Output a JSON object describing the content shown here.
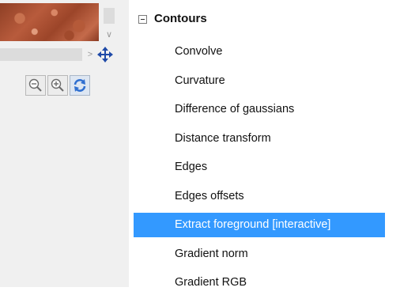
{
  "tree": {
    "category": "Contours",
    "selected_index": 6,
    "items": [
      "Convolve",
      "Curvature",
      "Difference of gaussians",
      "Distance transform",
      "Edges",
      "Edges offsets",
      "Extract foreground [interactive]",
      "Gradient norm",
      "Gradient RGB"
    ]
  },
  "toolbar": {
    "icons": [
      "zoom-out-icon",
      "zoom-in-icon",
      "refresh-icon",
      "move-icon"
    ]
  },
  "colors": {
    "selection": "#3399ff",
    "selection_text": "#ffffff",
    "move_icon": "#1f4aa8"
  }
}
